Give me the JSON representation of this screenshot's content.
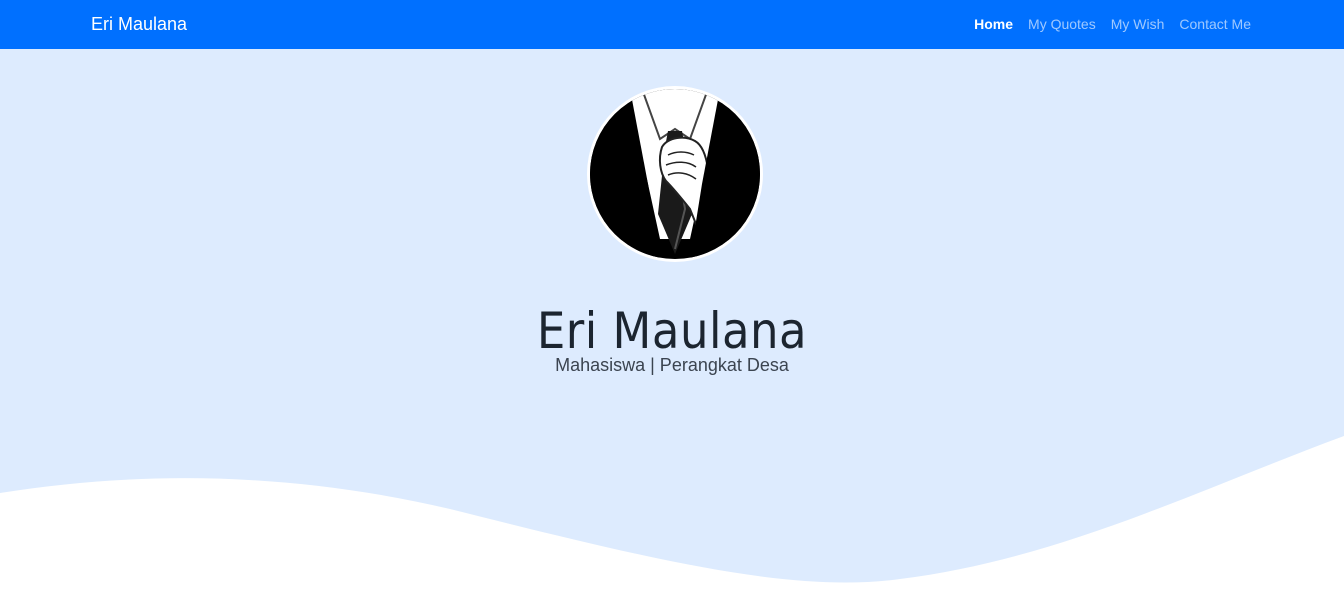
{
  "navbar": {
    "brand": "Eri Maulana",
    "links": [
      {
        "label": "Home",
        "active": true
      },
      {
        "label": "My Quotes",
        "active": false
      },
      {
        "label": "My Wish",
        "active": false
      },
      {
        "label": "Contact Me",
        "active": false
      }
    ]
  },
  "hero": {
    "name": "Eri Maulana",
    "subtitle": "Mahasiswa | Perangkat Desa",
    "avatar_icon": "suit-and-tie-avatar-icon"
  },
  "colors": {
    "navbar_bg": "#0070ff",
    "hero_bg": "#ddebfe",
    "wave_fill": "#ffffff"
  }
}
